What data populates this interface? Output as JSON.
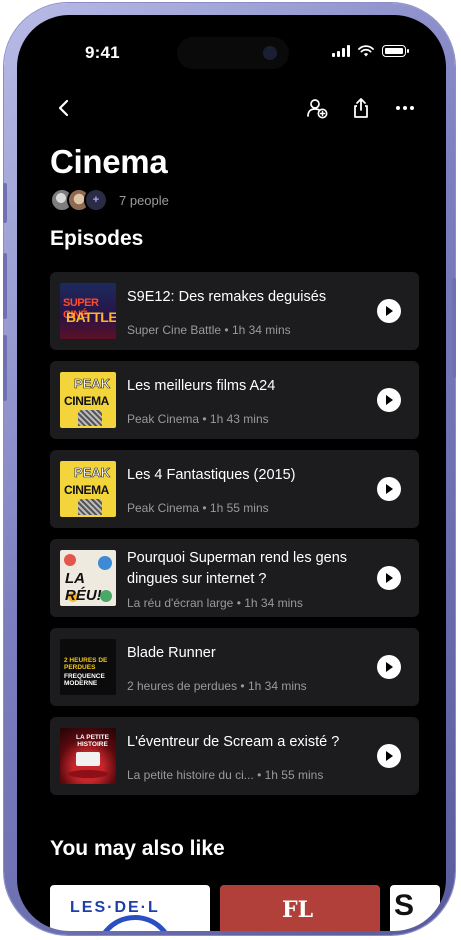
{
  "status_bar": {
    "time": "9:41"
  },
  "header": {
    "title": "Cinema",
    "people_count": "7 people",
    "add_member_symbol": "+"
  },
  "sections": {
    "episodes_title": "Episodes",
    "also_like_title": "You may also like"
  },
  "episodes": [
    {
      "title": "S9E12: Des remakes deguisés",
      "podcast": "Super Cine Battle",
      "duration": "1h 34 mins",
      "cover_text_1": "SUPER CINÉ",
      "cover_text_2": "BATTLE"
    },
    {
      "title": "Les meilleurs films A24",
      "podcast": "Peak Cinema",
      "duration": "1h 43 mins",
      "cover_text_1": "PEAK",
      "cover_text_2": "CINEMA"
    },
    {
      "title": "Les 4 Fantastiques (2015)",
      "podcast": "Peak Cinema",
      "duration": "1h 55 mins",
      "cover_text_1": "PEAK",
      "cover_text_2": "CINEMA"
    },
    {
      "title": "Pourquoi Superman rend les gens dingues sur internet ?",
      "podcast": "La réu d'écran large",
      "duration": "1h 34 mins",
      "cover_text_1": "LA RÉU!"
    },
    {
      "title": "Blade Runner",
      "podcast": "2 heures de perdues",
      "duration": "1h 34 mins",
      "cover_text_1": "2 HEURES DE PERDUES",
      "cover_text_2": "FREQUENCE MODERNE"
    },
    {
      "title": "L'éventreur de Scream a existé ?",
      "podcast": "La petite histoire du ci...",
      "duration": "1h 55 mins",
      "cover_text_1": "LA PETITE HISTOIRE"
    }
  ],
  "recommendations": [
    {
      "cover_text": "LES·DE·L"
    },
    {
      "cover_text": "FL"
    },
    {
      "cover_text": "S"
    }
  ],
  "icons": {
    "back": "chevron-left-icon",
    "add_person": "add-person-icon",
    "share": "share-icon",
    "more": "more-icon",
    "play": "play-icon"
  },
  "colors": {
    "background": "#000000",
    "card": "#1c1c1e",
    "secondary_text": "#9a9a9a",
    "frame": "#7b7fbf"
  }
}
